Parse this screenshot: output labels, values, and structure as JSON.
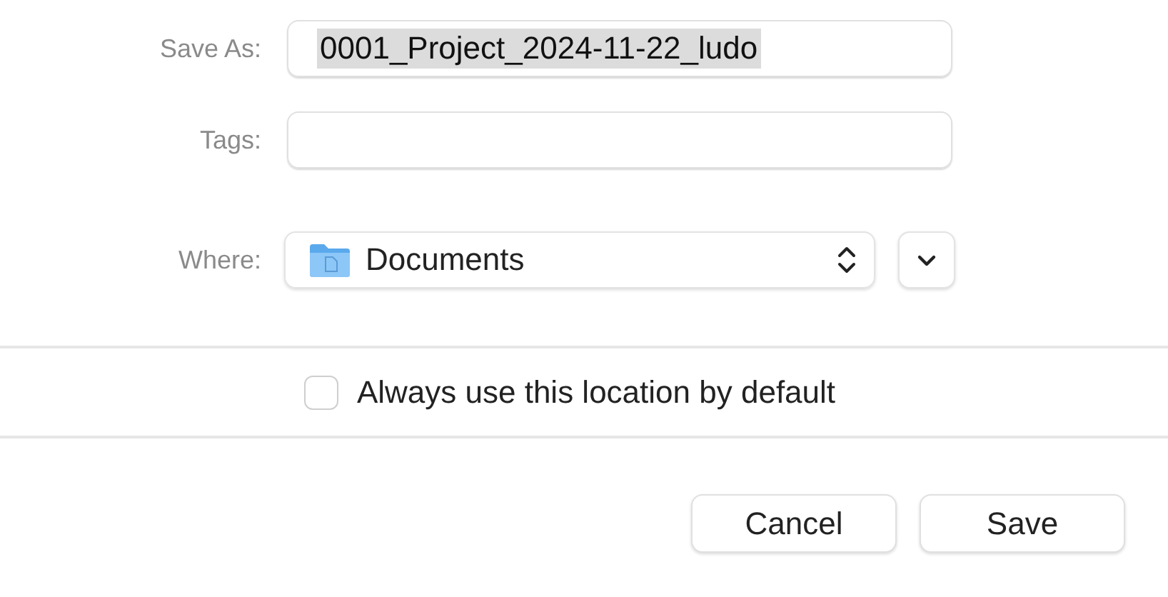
{
  "fields": [
    {
      "kind": "text",
      "label": "Save As:",
      "value": "0001_Project_2024-11-22_ludo",
      "text_selected": true
    },
    {
      "kind": "text",
      "label": "Tags:"
    },
    {
      "kind": "popup",
      "label": "Where:",
      "value": "Documents"
    }
  ],
  "option": {
    "label": "Always use this location by default",
    "checked": false
  },
  "buttons": [
    "Cancel",
    "Save"
  ]
}
